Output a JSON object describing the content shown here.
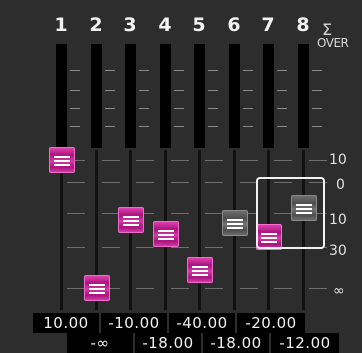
{
  "channels": [
    {
      "number": "1",
      "level_db": 10.0,
      "color": "pink"
    },
    {
      "number": "2",
      "level_db": -60.0,
      "color": "pink"
    },
    {
      "number": "3",
      "level_db": -10.0,
      "color": "pink"
    },
    {
      "number": "4",
      "level_db": -18.0,
      "color": "pink"
    },
    {
      "number": "5",
      "level_db": -40.0,
      "color": "pink"
    },
    {
      "number": "6",
      "level_db": -12.0,
      "color": "gray"
    },
    {
      "number": "7",
      "level_db": -20.0,
      "color": "pink"
    },
    {
      "number": "8",
      "level_db": -7.0,
      "color": "gray"
    }
  ],
  "sum_header": {
    "sigma": "Σ",
    "over": "OVER"
  },
  "scale": [
    "10",
    "0",
    "10",
    "30",
    "∞"
  ],
  "values_row1": [
    "10.00",
    "-10.00",
    "-40.00",
    "-20.00"
  ],
  "values_row2": [
    "-∞",
    "-18.00",
    "-18.00",
    "-12.00"
  ],
  "colors": {
    "pink": "#c1299a",
    "gray": "#5e5e5e",
    "background": "#2d2d2d"
  }
}
